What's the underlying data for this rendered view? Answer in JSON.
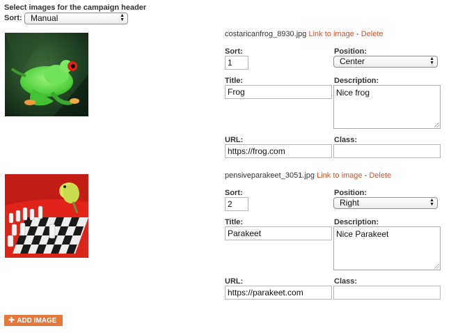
{
  "header": {
    "title": "Select images for the campaign header",
    "sort_label": "Sort:",
    "sort_value": "Manual"
  },
  "labels": {
    "sort": "Sort:",
    "position": "Position:",
    "title": "Title:",
    "description": "Description:",
    "url": "URL:",
    "class": "Class:",
    "link_to_image": "Link to image",
    "separator": "-",
    "delete": "Delete"
  },
  "images": [
    {
      "filename": "costaricanfrog_8930.jpg",
      "sort": "1",
      "position": "Center",
      "title": "Frog",
      "description": "Nice frog",
      "url": "https://frog.com",
      "class": ""
    },
    {
      "filename": "pensiveparakeet_3051.jpg",
      "sort": "2",
      "position": "Right",
      "title": "Parakeet",
      "description": "Nice Parakeet",
      "url": "https://parakeet.com",
      "class": ""
    }
  ],
  "add_button": {
    "icon": "plus-icon",
    "label": "ADD IMAGE"
  },
  "colors": {
    "link": "#d9502a",
    "button": "#e8773c"
  }
}
